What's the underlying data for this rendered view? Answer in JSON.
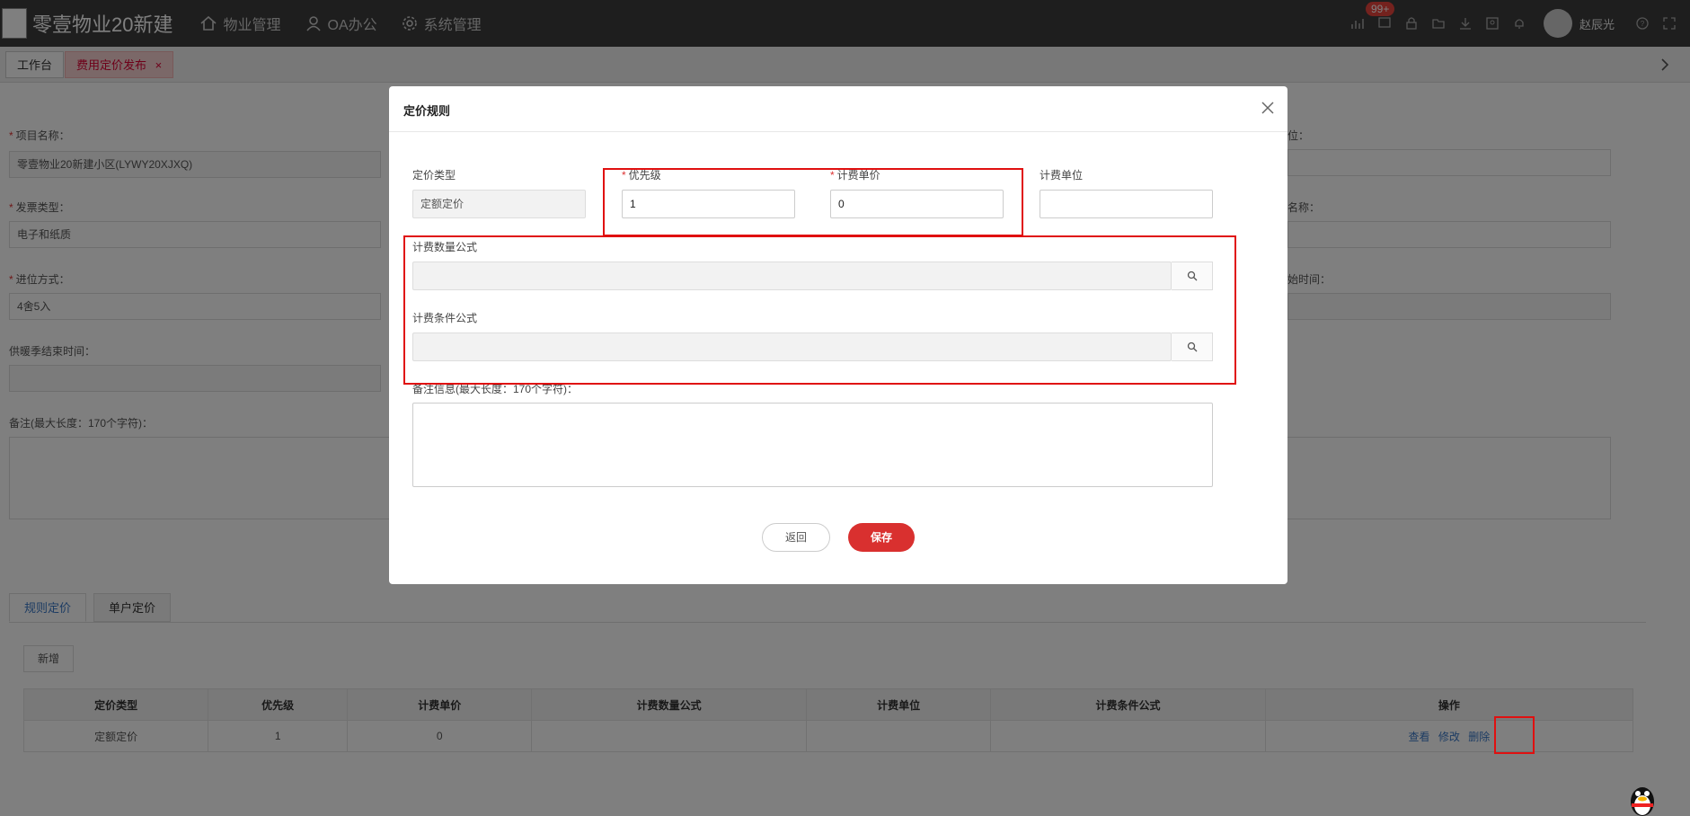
{
  "header": {
    "app_title": "零壹物业20新建",
    "nav": [
      "物业管理",
      "OA办公",
      "系统管理"
    ],
    "notification_badge": "99+",
    "username": "赵辰光"
  },
  "tabs": {
    "workbench": "工作台",
    "active": "费用定价发布",
    "close_glyph": "×"
  },
  "form": {
    "project_name_label": "项目名称：",
    "project_name_value": "零壹物业20新建小区(LYWY20XJXQ)",
    "invoice_type_label": "发票类型：",
    "invoice_type_value": "电子和纸质",
    "rounding_label": "进位方式：",
    "rounding_value": "4舍5入",
    "heating_end_label": "供暖季结束时间：",
    "remark_label": "备注(最大长度：170个字符)：",
    "right_label_1": "位：",
    "right_label_2": "名称：",
    "right_label_3": "始时间："
  },
  "sub_tabs": [
    "规则定价",
    "单户定价"
  ],
  "add_button": "新增",
  "table": {
    "headers": [
      "定价类型",
      "优先级",
      "计费单价",
      "计费数量公式",
      "计费单位",
      "计费条件公式",
      "操作"
    ],
    "rows": [
      {
        "type": "定额定价",
        "priority": "1",
        "unit_price": "0",
        "qty_formula": "",
        "unit": "",
        "cond_formula": ""
      }
    ],
    "actions": [
      "查看",
      "修改",
      "删除"
    ]
  },
  "modal": {
    "title": "定价规则",
    "pricing_type_label": "定价类型",
    "pricing_type_value": "定额定价",
    "priority_label": "优先级",
    "priority_value": "1",
    "unit_price_label": "计费单价",
    "unit_price_value": "0",
    "billing_unit_label": "计费单位",
    "billing_unit_value": "",
    "qty_formula_label": "计费数量公式",
    "cond_formula_label": "计费条件公式",
    "remark_label": "备注信息(最大长度：170个字符)：",
    "back_button": "返回",
    "save_button": "保存"
  }
}
